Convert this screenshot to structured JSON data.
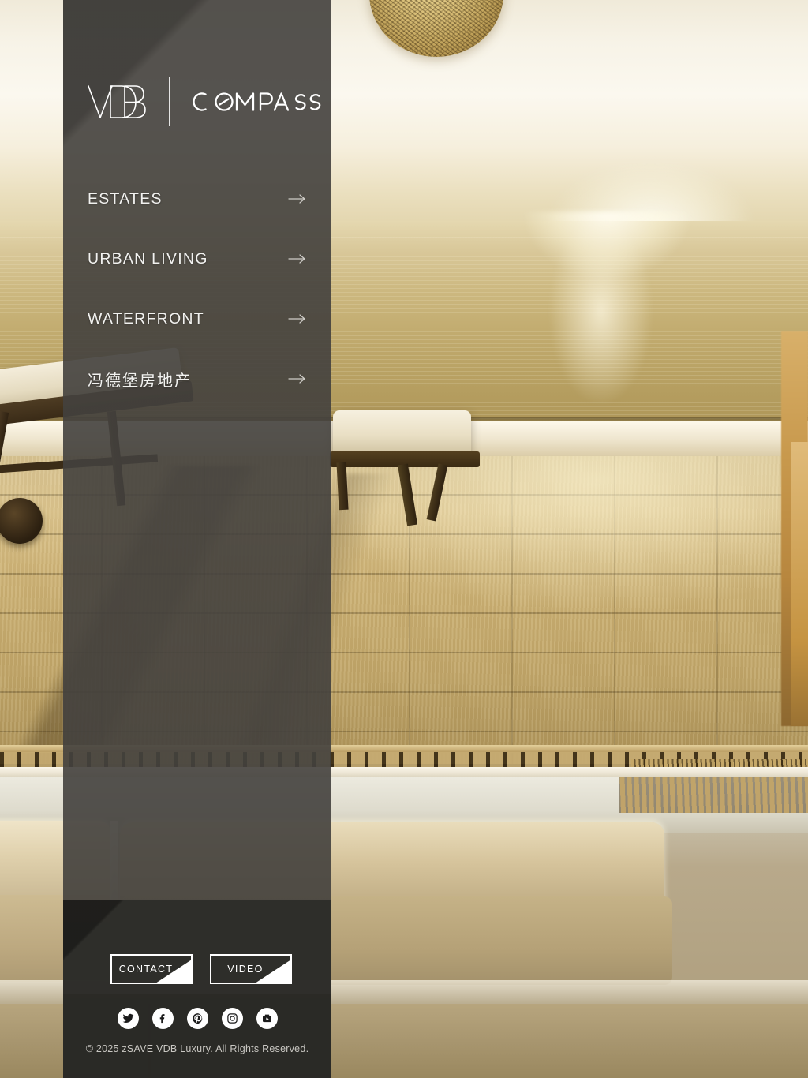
{
  "brand": {
    "logo_primary": "VDB",
    "logo_secondary": "COMPASS",
    "divider": "|"
  },
  "nav": {
    "items": [
      {
        "label": "ESTATES",
        "arrow": "→",
        "cjk": false
      },
      {
        "label": "URBAN LIVING",
        "arrow": "→",
        "cjk": false
      },
      {
        "label": "WATERFRONT",
        "arrow": "→",
        "cjk": false
      },
      {
        "label": "冯德堡房地产",
        "arrow": "→",
        "cjk": true
      }
    ]
  },
  "cta": {
    "contact_label": "CONTACT",
    "video_label": "VIDEO"
  },
  "social": {
    "items": [
      {
        "name": "twitter-icon",
        "title": "Twitter"
      },
      {
        "name": "facebook-icon",
        "title": "Facebook"
      },
      {
        "name": "pinterest-icon",
        "title": "Pinterest"
      },
      {
        "name": "instagram-icon",
        "title": "Instagram"
      },
      {
        "name": "youtube-icon",
        "title": "YouTube"
      }
    ]
  },
  "footer": {
    "copyright": "© 2025 zSAVE VDB Luxury. All Rights Reserved."
  },
  "colors": {
    "panel": "#3e3c38",
    "panel_footer": "#262522",
    "text": "#f2f2f0",
    "muted": "#c9c7c2",
    "accent_white": "#ffffff"
  },
  "background": {
    "description": "Sunset terrace overlooking golden sea with lounge chairs and sofa"
  }
}
